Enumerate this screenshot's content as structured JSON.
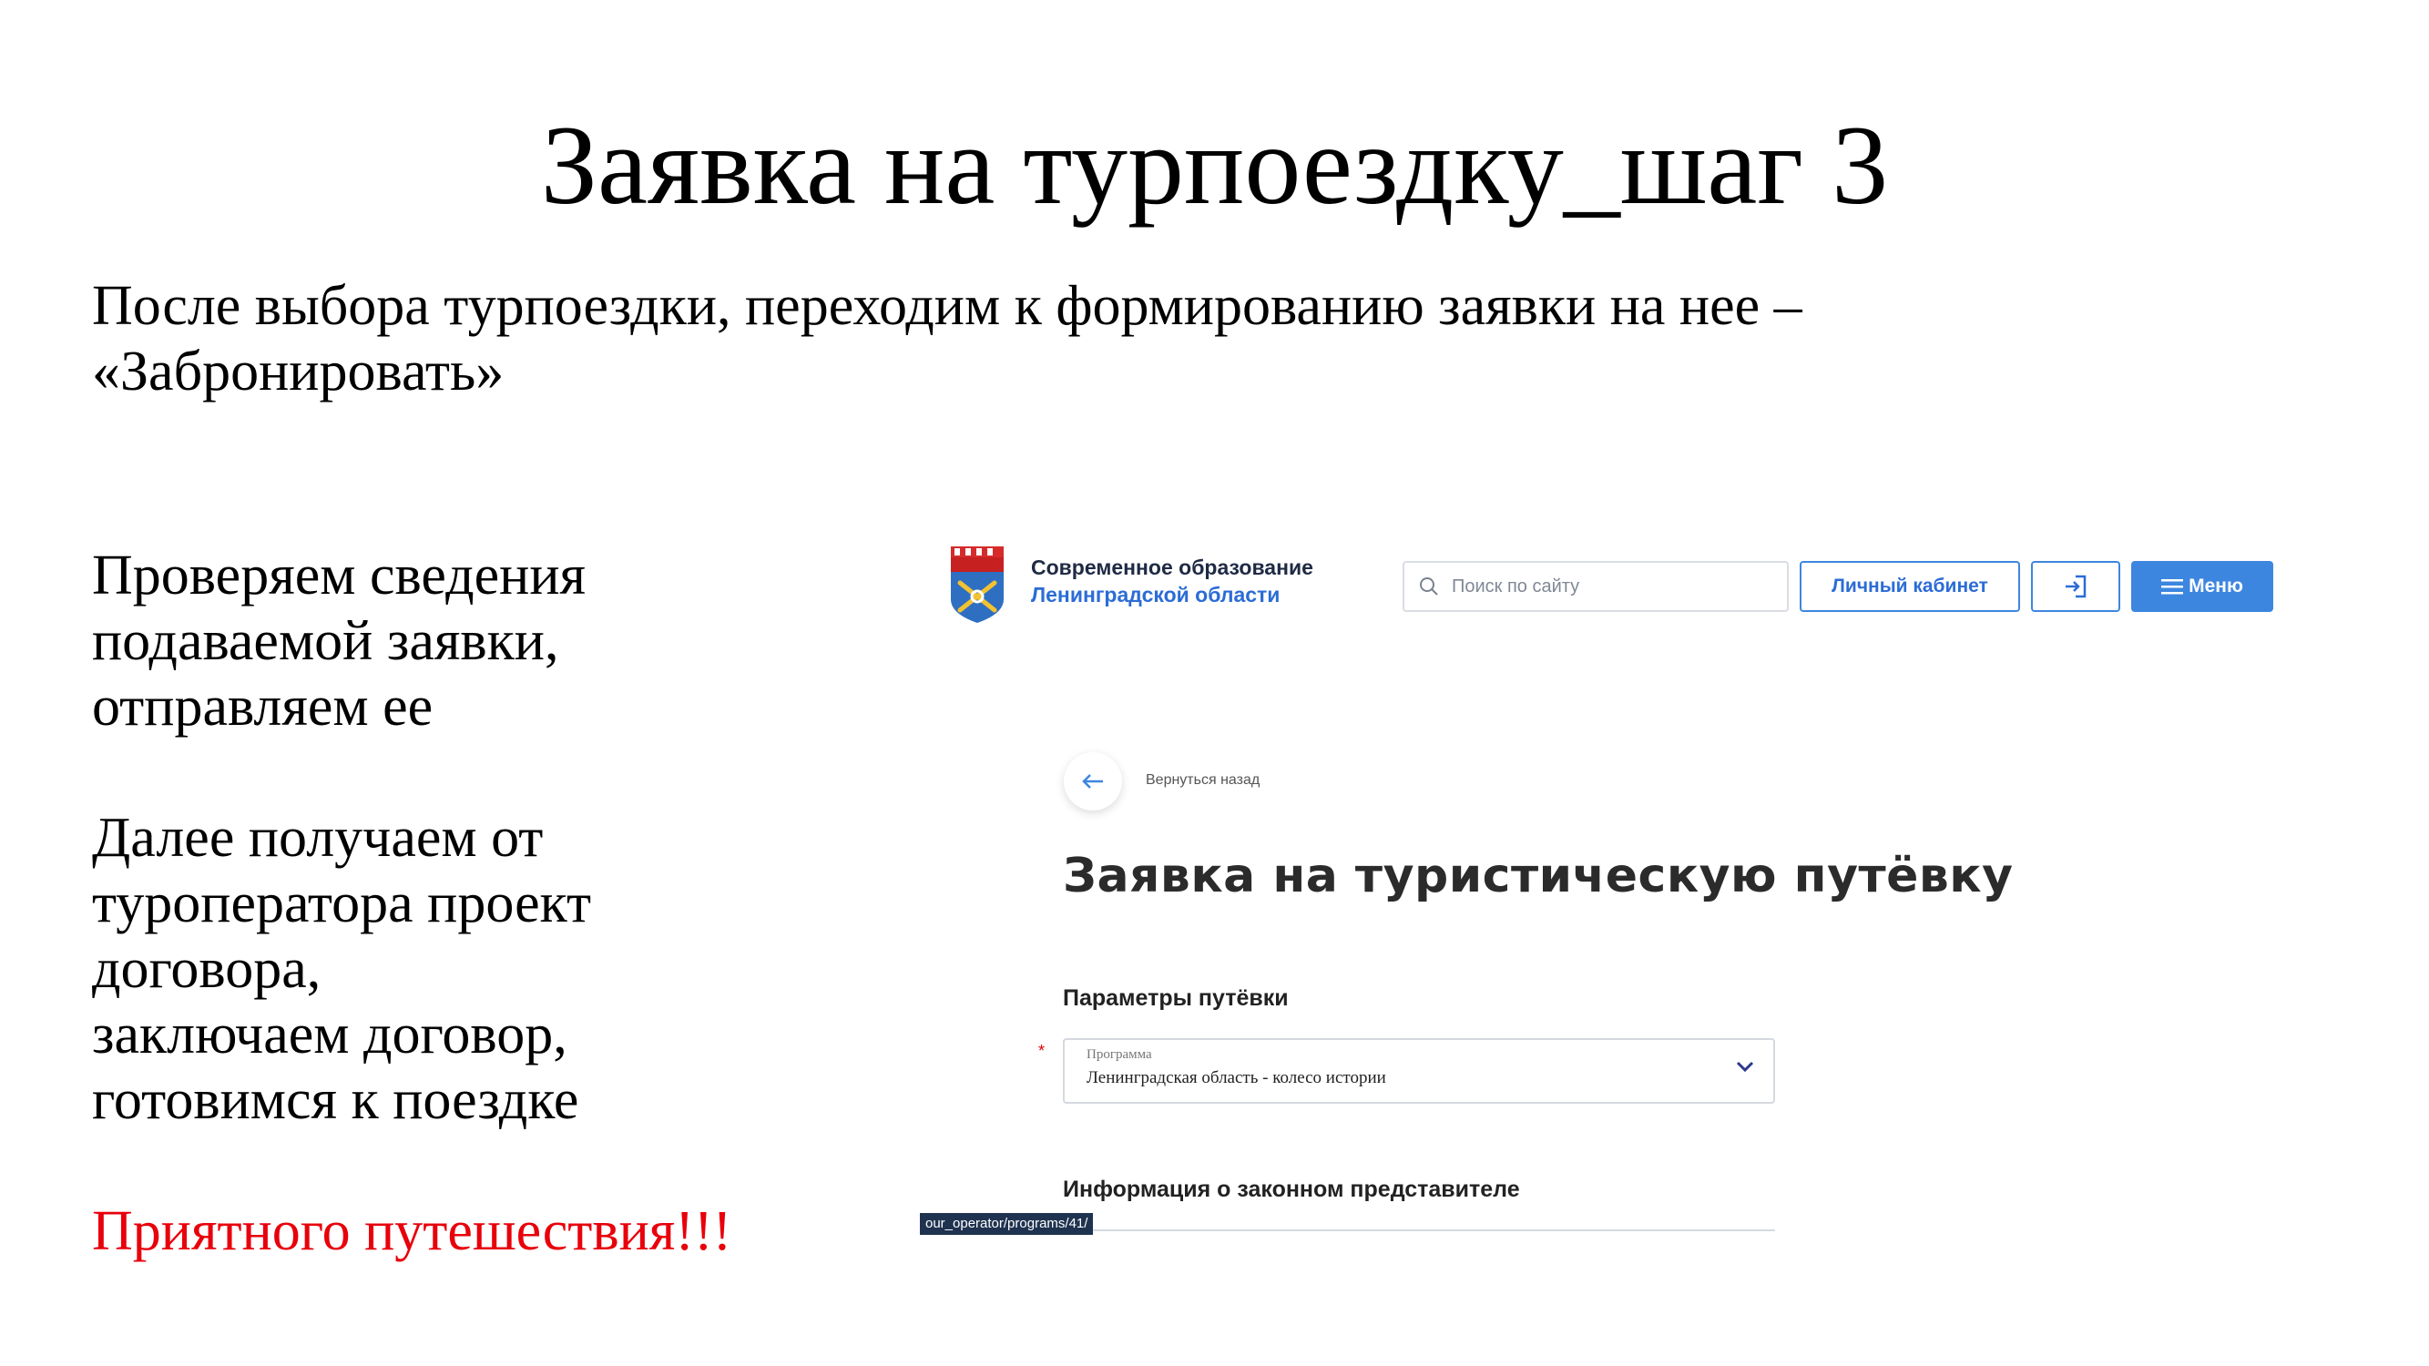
{
  "slide": {
    "title": "Заявка на турпоездку_шаг 3",
    "intro_line1": "После выбора турпоездки, переходим к формированию заявки на нее –",
    "intro_line2": "«Забронировать»",
    "left_paragraph1": [
      "Проверяем сведения",
      "подаваемой заявки,",
      "отправляем ее"
    ],
    "left_paragraph2": [
      "Далее получаем от",
      "туроператора проект",
      "договора,",
      "заключаем договор,",
      "готовимся к поездке"
    ],
    "closing": "Приятного путешествия!!!",
    "closing_color": "#e8000b"
  },
  "screenshot": {
    "brand_line1": "Современное образование",
    "brand_line2": "Ленинградской области",
    "search_placeholder": "Поиск по сайту",
    "cabinet_label": "Личный кабинет",
    "menu_label": "Меню",
    "back_label": "Вернуться назад",
    "form_title": "Заявка на туристическую путёвку",
    "section_params": "Параметры путёвки",
    "required_mark": "*",
    "program_label": "Программа",
    "program_value": "Ленинградская область - колесо истории",
    "section_representative": "Информация о законном представителе",
    "status_url": "our_operator/programs/41/",
    "accent_color": "#3d86e0",
    "icons": [
      "emblem-logo",
      "search-icon",
      "login-icon",
      "menu-icon",
      "back-arrow-icon",
      "chevron-down-icon"
    ]
  }
}
